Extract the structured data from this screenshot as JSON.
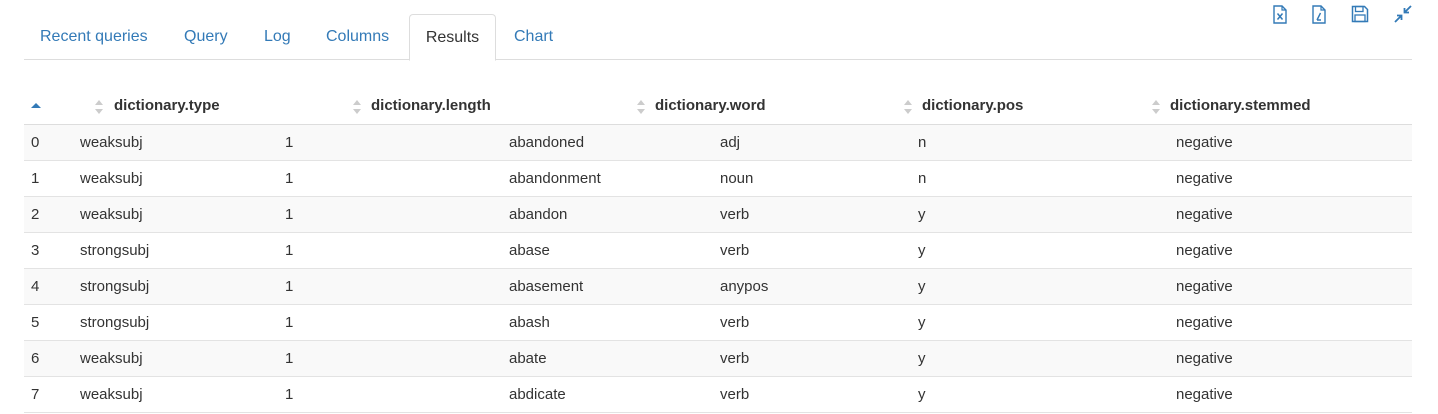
{
  "toolbar": {
    "icons": [
      "excel-export-icon",
      "csv-export-icon",
      "save-icon",
      "collapse-icon"
    ],
    "accent_color": "#337ab7"
  },
  "tabs": [
    {
      "label": "Recent queries"
    },
    {
      "label": "Query"
    },
    {
      "label": "Log"
    },
    {
      "label": "Columns"
    },
    {
      "label": "Results",
      "active": true
    },
    {
      "label": "Chart"
    }
  ],
  "table": {
    "columns": [
      "",
      "dictionary.type",
      "dictionary.length",
      "dictionary.word",
      "dictionary.pos",
      "dictionary.stemmed"
    ],
    "rows": [
      [
        "0",
        "weaksubj",
        "1",
        "abandoned",
        "adj",
        "n",
        "negative"
      ],
      [
        "1",
        "weaksubj",
        "1",
        "abandonment",
        "noun",
        "n",
        "negative"
      ],
      [
        "2",
        "weaksubj",
        "1",
        "abandon",
        "verb",
        "y",
        "negative"
      ],
      [
        "3",
        "strongsubj",
        "1",
        "abase",
        "verb",
        "y",
        "negative"
      ],
      [
        "4",
        "strongsubj",
        "1",
        "abasement",
        "anypos",
        "y",
        "negative"
      ],
      [
        "5",
        "strongsubj",
        "1",
        "abash",
        "verb",
        "y",
        "negative"
      ],
      [
        "6",
        "weaksubj",
        "1",
        "abate",
        "verb",
        "y",
        "negative"
      ],
      [
        "7",
        "weaksubj",
        "1",
        "abdicate",
        "verb",
        "y",
        "negative"
      ]
    ]
  }
}
